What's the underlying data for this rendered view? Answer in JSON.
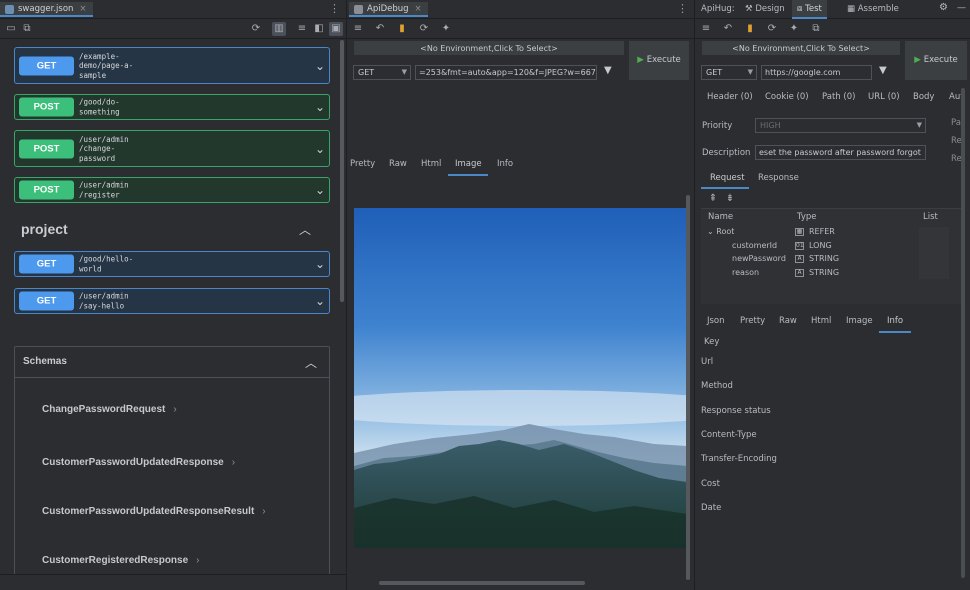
{
  "left": {
    "tab_title": "swagger.json",
    "endpoints": [
      {
        "method": "GET",
        "path": "/example-\ndemo/page-a-\nsample"
      },
      {
        "method": "POST",
        "path": "/good/do-\nsomething"
      },
      {
        "method": "POST",
        "path": "/user/admin\n/change-\npassword"
      },
      {
        "method": "POST",
        "path": "/user/admin\n/register"
      }
    ],
    "section_title": "project",
    "project_endpoints": [
      {
        "method": "GET",
        "path": "/good/hello-\nworld"
      },
      {
        "method": "GET",
        "path": "/user/admin\n/say-hello"
      }
    ],
    "schemas_title": "Schemas",
    "schemas": [
      "ChangePasswordRequest",
      "CustomerPasswordUpdatedResponse",
      "CustomerPasswordUpdatedResponseResult",
      "CustomerRegisteredResponse"
    ]
  },
  "mid": {
    "tab_title": "ApiDebug",
    "env_label": "<No Environment,Click To Select>",
    "execute_label": "Execute",
    "method": "GET",
    "url": "=253&fmt=auto&app=120&f=JPEG?w=667&",
    "tabs": [
      "Pretty",
      "Raw",
      "Html",
      "Image",
      "Info"
    ],
    "active_tab": "Image"
  },
  "right": {
    "app_label": "ApiHug:",
    "tabs": [
      "Design",
      "Test",
      "Assemble"
    ],
    "env_label": "<No Environment,Click To Select>",
    "execute_label": "Execute",
    "method": "GET",
    "url": "https://google.com",
    "param_tabs": [
      "Header (0)",
      "Cookie (0)",
      "Path (0)",
      "URL (0)",
      "Body",
      "Aut"
    ],
    "priority_label": "Priority",
    "priority_value": "HIGH",
    "description_label": "Description",
    "description_value": "eset the password after password forgot",
    "side_labels": [
      "Pa",
      "Re",
      "Re"
    ],
    "req_tabs": [
      "Request",
      "Response"
    ],
    "tree_headers": [
      "Name",
      "Type",
      "List"
    ],
    "tree_rows": [
      {
        "name": "Root",
        "type": "REFER",
        "icon": "ref"
      },
      {
        "name": "customerId",
        "type": "LONG",
        "icon": "num"
      },
      {
        "name": "newPassword",
        "type": "STRING",
        "icon": "str"
      },
      {
        "name": "reason",
        "type": "STRING",
        "icon": "str"
      }
    ],
    "resp_tabs": [
      "Json",
      "Pretty",
      "Raw",
      "Html",
      "Image",
      "Info"
    ],
    "active_resp_tab": "Info",
    "info_keys": [
      "Key",
      "Url",
      "Method",
      "Response status",
      "Content-Type",
      "Transfer-Encoding",
      "Cost",
      "Date"
    ]
  },
  "colors": {
    "get": "#4d99ee",
    "post": "#3cbf7a",
    "accent": "#4a88c7"
  }
}
